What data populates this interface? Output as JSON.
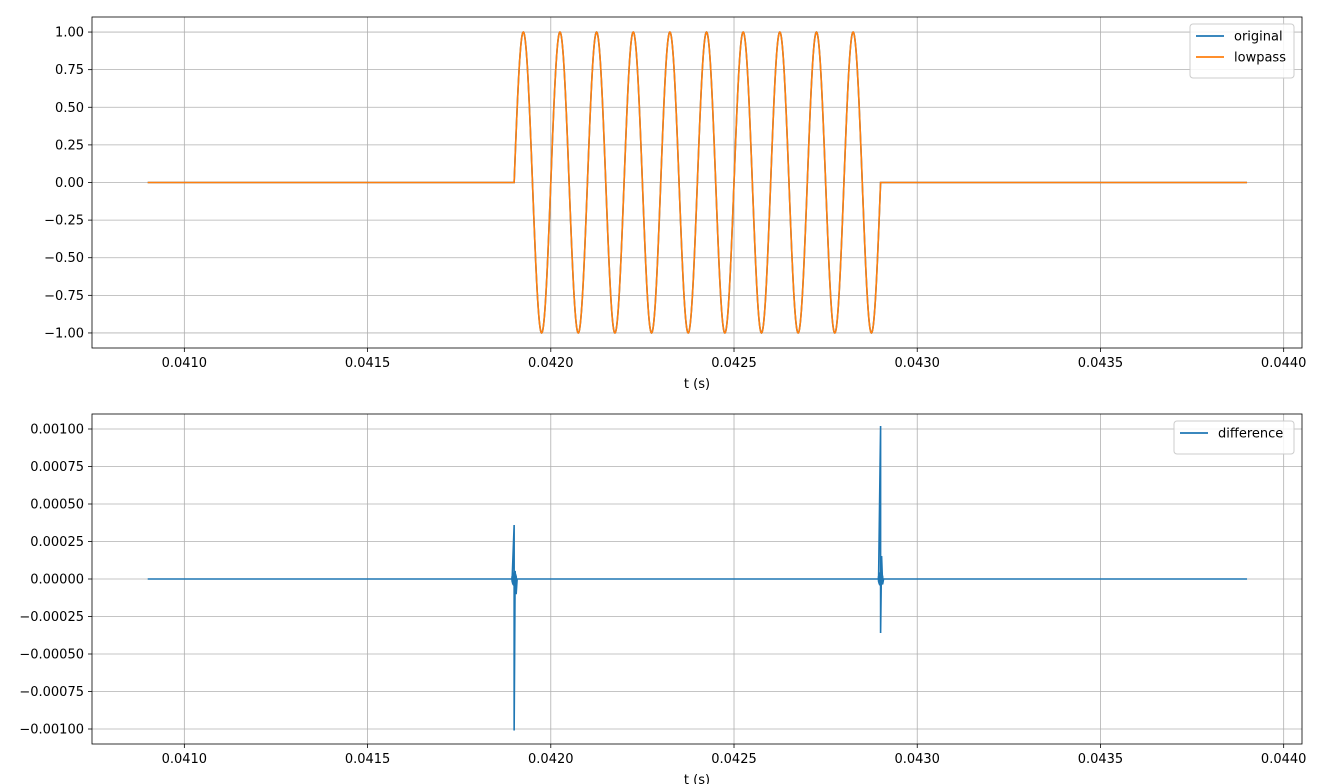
{
  "chart_data": [
    {
      "type": "line",
      "xlabel": "t (s)",
      "ylabel": "",
      "xlim": [
        0.040748,
        0.04405
      ],
      "ylim": [
        -1.1,
        1.1
      ],
      "xticks": [
        0.041,
        0.0415,
        0.042,
        0.0425,
        0.043,
        0.0435,
        0.044
      ],
      "xtick_labels": [
        "0.0410",
        "0.0415",
        "0.0420",
        "0.0425",
        "0.0430",
        "0.0435",
        "0.0440"
      ],
      "yticks": [
        -1.0,
        -0.75,
        -0.5,
        -0.25,
        0.0,
        0.25,
        0.5,
        0.75,
        1.0
      ],
      "ytick_labels": [
        "−1.00",
        "−0.75",
        "−0.50",
        "−0.25",
        "0.00",
        "0.25",
        "0.50",
        "0.75",
        "1.00"
      ],
      "grid": true,
      "legend": "upper right",
      "signal": {
        "t_start": 0.0409,
        "t_end": 0.0439,
        "burst_start": 0.0419,
        "burst_end": 0.0429,
        "tone_frequency_hz": 10000,
        "amplitude": 1.0
      },
      "series": [
        {
          "name": "original",
          "color": "#1f77b4"
        },
        {
          "name": "lowpass",
          "color": "#ff7f0e"
        }
      ]
    },
    {
      "type": "line",
      "xlabel": "t (s)",
      "ylabel": "",
      "xlim": [
        0.040748,
        0.04405
      ],
      "ylim": [
        -0.0011,
        0.0011
      ],
      "xticks": [
        0.041,
        0.0415,
        0.042,
        0.0425,
        0.043,
        0.0435,
        0.044
      ],
      "xtick_labels": [
        "0.0410",
        "0.0415",
        "0.0420",
        "0.0425",
        "0.0430",
        "0.0435",
        "0.0440"
      ],
      "yticks": [
        -0.001,
        -0.00075,
        -0.0005,
        -0.00025,
        0.0,
        0.00025,
        0.0005,
        0.00075,
        0.001
      ],
      "ytick_labels": [
        "−0.00100",
        "−0.00075",
        "−0.00050",
        "−0.00025",
        "0.00000",
        "0.00025",
        "0.00050",
        "0.00075",
        "0.00100"
      ],
      "grid": true,
      "legend": "upper right",
      "series": [
        {
          "name": "difference",
          "color": "#1f77b4",
          "baseline": 0.0,
          "spikes": [
            {
              "t": 0.0419,
              "max": 0.00036,
              "min": -0.00101
            },
            {
              "t": 0.0429,
              "max": 0.00102,
              "min": -0.00036
            }
          ]
        }
      ]
    }
  ]
}
